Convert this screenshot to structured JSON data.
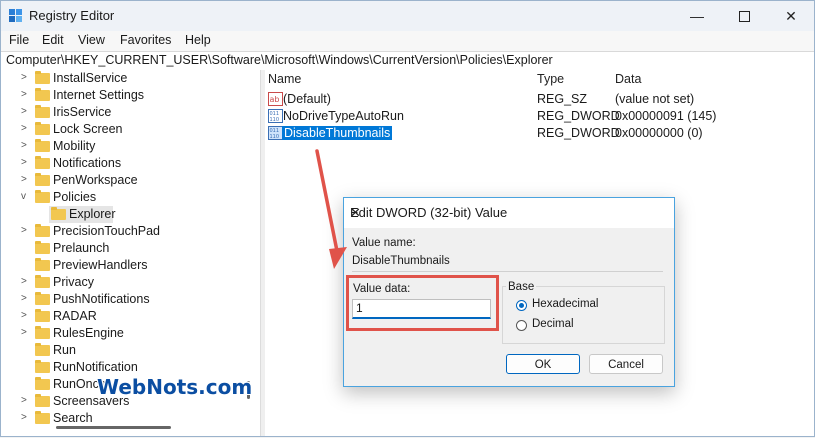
{
  "window": {
    "title": "Registry Editor"
  },
  "menu": [
    "File",
    "Edit",
    "View",
    "Favorites",
    "Help"
  ],
  "address": "Computer\\HKEY_CURRENT_USER\\Software\\Microsoft\\Windows\\CurrentVersion\\Policies\\Explorer",
  "tree": [
    {
      "label": "InstallService",
      "expander": ">"
    },
    {
      "label": "Internet Settings",
      "expander": ">"
    },
    {
      "label": "IrisService",
      "expander": ">"
    },
    {
      "label": "Lock Screen",
      "expander": ">"
    },
    {
      "label": "Mobility",
      "expander": ">"
    },
    {
      "label": "Notifications",
      "expander": ">"
    },
    {
      "label": "PenWorkspace",
      "expander": ">"
    },
    {
      "label": "Policies",
      "expander": "v"
    },
    {
      "label": "Explorer",
      "expander": ""
    },
    {
      "label": "PrecisionTouchPad",
      "expander": ">"
    },
    {
      "label": "Prelaunch",
      "expander": ""
    },
    {
      "label": "PreviewHandlers",
      "expander": ""
    },
    {
      "label": "Privacy",
      "expander": ">"
    },
    {
      "label": "PushNotifications",
      "expander": ">"
    },
    {
      "label": "RADAR",
      "expander": ">"
    },
    {
      "label": "RulesEngine",
      "expander": ">"
    },
    {
      "label": "Run",
      "expander": ""
    },
    {
      "label": "RunNotification",
      "expander": ""
    },
    {
      "label": "RunOnce",
      "expander": ""
    },
    {
      "label": "Screensavers",
      "expander": ">"
    },
    {
      "label": "Search",
      "expander": ">"
    }
  ],
  "list": {
    "headers": {
      "name": "Name",
      "type": "Type",
      "data": "Data"
    },
    "rows": [
      {
        "icon": "string-value-icon",
        "name": "(Default)",
        "type": "REG_SZ",
        "data": "(value not set)"
      },
      {
        "icon": "dword-value-icon",
        "name": "NoDriveTypeAutoRun",
        "type": "REG_DWORD",
        "data": "0x00000091 (145)"
      },
      {
        "icon": "dword-value-icon",
        "name": "DisableThumbnails",
        "type": "REG_DWORD",
        "data": "0x00000000 (0)"
      }
    ]
  },
  "dialog": {
    "title": "Edit DWORD (32-bit) Value",
    "value_name_label": "Value name:",
    "value_name": "DisableThumbnails",
    "value_data_label": "Value data:",
    "value_data": "1",
    "base_label": "Base",
    "hex_label": "Hexadecimal",
    "dec_label": "Decimal",
    "selected_base": "Hexadecimal",
    "ok": "OK",
    "cancel": "Cancel"
  },
  "watermark": "WebNots.com",
  "colors": {
    "highlight_red": "#e0534a",
    "selection_blue": "#0078d7",
    "accent": "#0067c0"
  }
}
